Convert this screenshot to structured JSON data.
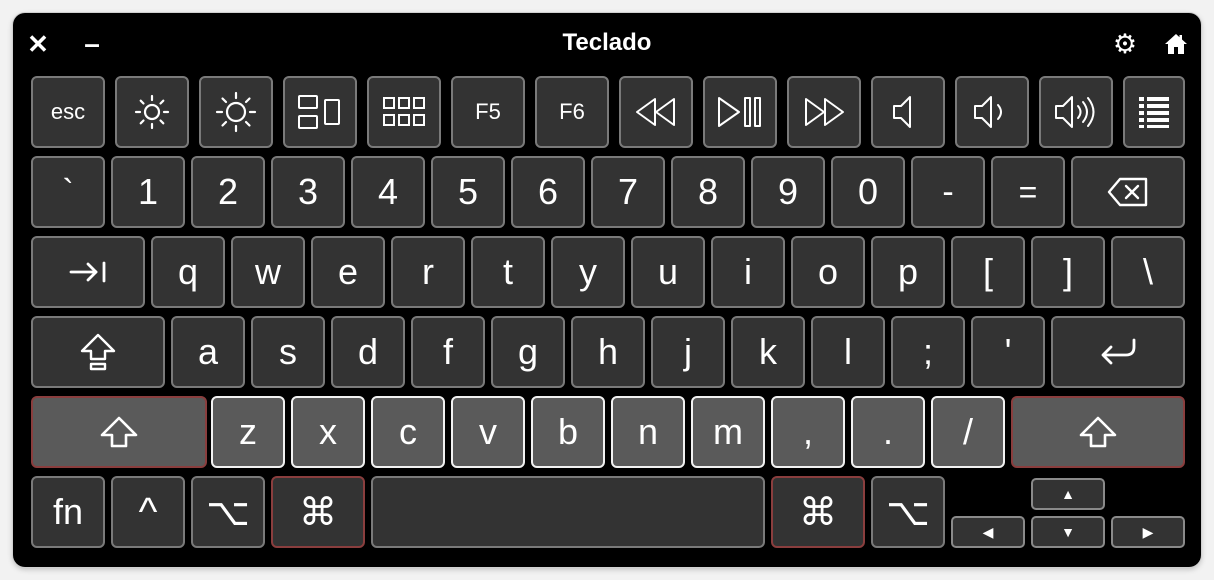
{
  "window": {
    "title": "Teclado",
    "close_label": "✕",
    "minimize_label": "–"
  },
  "colors": {
    "window_bg": "#000000",
    "key_bg": "#333333",
    "key_pressed_bg": "#5a5a5a",
    "key_border": "#7a7a7a",
    "key_pressed_border": "#f2f2f2",
    "modifier_active_border": "#8a3e3e",
    "text": "#ffffff"
  },
  "keys": {
    "function_row": {
      "esc": "esc",
      "brightness_down": "brightness-down-icon",
      "brightness_up": "brightness-up-icon",
      "mission_control": "mission-control-icon",
      "launchpad": "launchpad-icon",
      "f5": "F5",
      "f6": "F6",
      "rewind": "rewind-icon",
      "play_pause": "play-pause-icon",
      "fast_forward": "fast-forward-icon",
      "mute": "mute-icon",
      "volume_down": "volume-down-icon",
      "volume_up": "volume-up-icon",
      "menu": "list-icon"
    },
    "number_row": [
      "`",
      "1",
      "2",
      "3",
      "4",
      "5",
      "6",
      "7",
      "8",
      "9",
      "0",
      "-",
      "="
    ],
    "delete": "delete-icon",
    "tab": "tab-icon",
    "qwerty_row": [
      "q",
      "w",
      "e",
      "r",
      "t",
      "y",
      "u",
      "i",
      "o",
      "p",
      "[",
      "]",
      "\\"
    ],
    "caps_lock": "caps-lock-icon",
    "home_row": [
      "a",
      "s",
      "d",
      "f",
      "g",
      "h",
      "j",
      "k",
      "l",
      ";",
      "'"
    ],
    "return": "return-icon",
    "shift": "shift-icon",
    "bottom_letter_row": [
      "z",
      "x",
      "c",
      "v",
      "b",
      "n",
      "m",
      ",",
      ".",
      "/"
    ],
    "fn": "fn",
    "control": "^",
    "option": "⌥",
    "command": "⌘",
    "arrows": {
      "up": "▲",
      "left": "◀",
      "down": "▼",
      "right": "▶"
    }
  }
}
